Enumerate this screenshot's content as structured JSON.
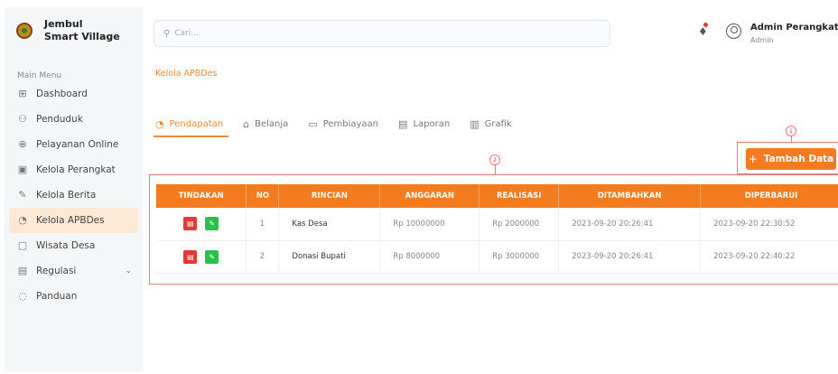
{
  "brand": {
    "line1": "Jembul",
    "line2": "Smart Village"
  },
  "sidebar": {
    "heading": "Main Menu",
    "items": [
      {
        "label": "Dashboard",
        "icon": "grid-icon",
        "glyph": "⊞"
      },
      {
        "label": "Penduduk",
        "icon": "users-icon",
        "glyph": "⚇"
      },
      {
        "label": "Pelayanan Online",
        "icon": "globe-icon",
        "glyph": "⊕"
      },
      {
        "label": "Kelola Perangkat",
        "icon": "id-card-icon",
        "glyph": "▣"
      },
      {
        "label": "Kelola Berita",
        "icon": "edit-icon",
        "glyph": "✎"
      },
      {
        "label": "Kelola APBDes",
        "icon": "coin-icon",
        "glyph": "◔"
      },
      {
        "label": "Wisata Desa",
        "icon": "image-icon",
        "glyph": "▢"
      },
      {
        "label": "Regulasi",
        "icon": "document-icon",
        "glyph": "▤"
      },
      {
        "label": "Panduan",
        "icon": "lightbulb-icon",
        "glyph": "◌"
      }
    ]
  },
  "search": {
    "placeholder": "Cari..."
  },
  "user": {
    "name": "Admin Perangkat Desa",
    "role": "Admin"
  },
  "breadcrumb": "Kelola APBDes",
  "tabs": [
    {
      "label": "Pendapatan",
      "icon": "coin-icon",
      "glyph": "◔"
    },
    {
      "label": "Belanja",
      "icon": "bag-icon",
      "glyph": "⌂"
    },
    {
      "label": "Pembiayaan",
      "icon": "wallet-icon",
      "glyph": "▭"
    },
    {
      "label": "Laporan",
      "icon": "report-icon",
      "glyph": "▤"
    },
    {
      "label": "Grafik",
      "icon": "bar-chart-icon",
      "glyph": "▥"
    }
  ],
  "markers": {
    "m1": "1",
    "m2": "2"
  },
  "add_button": {
    "label": "Tambah Data"
  },
  "table": {
    "headers": [
      "TINDAKAN",
      "NO",
      "RINCIAN",
      "ANGGARAN",
      "REALISASI",
      "DITAMBAHKAN",
      "DIPERBARUI"
    ],
    "rows": [
      {
        "no": "1",
        "rincian": "Kas Desa",
        "anggaran": "Rp 10000000",
        "realisasi": "Rp 2000000",
        "ditambahkan": "2023-09-20 20:26:41",
        "diperbarui": "2023-09-20 22:30:52"
      },
      {
        "no": "2",
        "rincian": "Donasi Bupati",
        "anggaran": "Rp 8000000",
        "realisasi": "Rp 3000000",
        "ditambahkan": "2023-09-20 20:26:41",
        "diperbarui": "2023-09-20 22:40:22"
      }
    ]
  },
  "colors": {
    "accent": "#f47c20",
    "active_bg": "#fde8d6",
    "delete": "#e53935",
    "edit": "#27c24c",
    "highlight": "#e87b7b"
  }
}
